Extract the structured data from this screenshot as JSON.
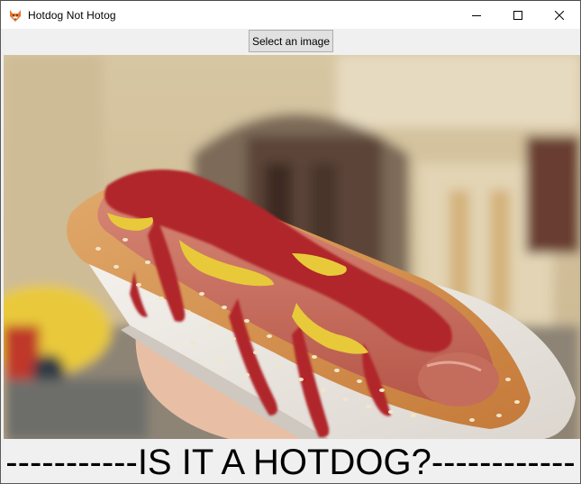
{
  "window": {
    "title": "Hotdog Not Hotog",
    "app_icon": "fox-icon",
    "controls": [
      "minimize-icon",
      "maximize-icon",
      "close-icon"
    ]
  },
  "toolbar": {
    "select_label": "Select an image"
  },
  "image": {
    "subject": "hotdog-photo"
  },
  "result": {
    "text": "-----------IS IT A HOTDOG?------------"
  }
}
